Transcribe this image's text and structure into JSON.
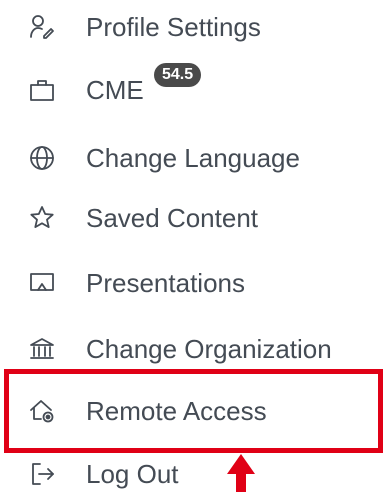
{
  "menu": {
    "items": [
      {
        "label": "Profile Settings",
        "icon": "user-gear-icon"
      },
      {
        "label": "CME",
        "icon": "briefcase-icon",
        "badge": "54.5"
      },
      {
        "label": "Change Language",
        "icon": "globe-icon"
      },
      {
        "label": "Saved Content",
        "icon": "star-icon"
      },
      {
        "label": "Presentations",
        "icon": "presentation-screen-icon"
      },
      {
        "label": "Change Organization",
        "icon": "institution-icon"
      },
      {
        "label": "Remote Access",
        "icon": "home-remote-icon"
      },
      {
        "label": "Log Out",
        "icon": "logout-icon"
      }
    ]
  },
  "annotation": {
    "highlight_color": "#e00016",
    "arrow_color": "#e00016"
  }
}
